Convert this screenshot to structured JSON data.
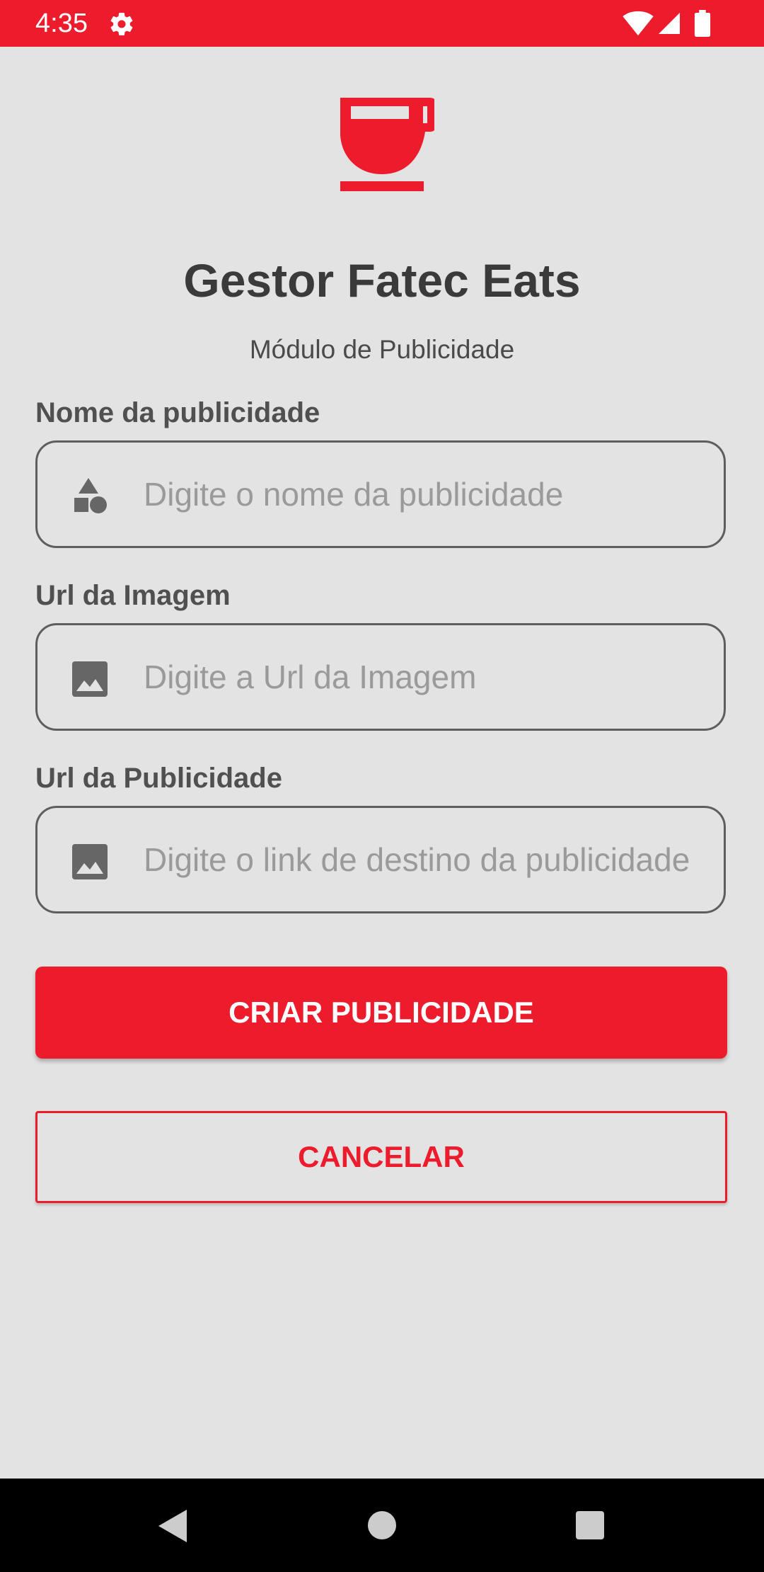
{
  "status_bar": {
    "time": "4:35",
    "icons": [
      "gear-icon",
      "wifi-icon",
      "signal-icon",
      "battery-icon"
    ],
    "background": "#ec1c2c"
  },
  "header": {
    "logo_icon": "coffee-cup-icon",
    "title": "Gestor Fatec Eats",
    "subtitle": "Módulo de Publicidade"
  },
  "form": {
    "fields": [
      {
        "label": "Nome da publicidade",
        "placeholder": "Digite o nome da publicidade",
        "value": "",
        "icon": "shapes-icon"
      },
      {
        "label": "Url da Imagem",
        "placeholder": "Digite a Url da Imagem",
        "value": "",
        "icon": "image-icon"
      },
      {
        "label": "Url da Publicidade",
        "placeholder": "Digite o link de destino da publicidade",
        "value": "",
        "icon": "image-icon"
      }
    ],
    "submit_label": "CRIAR PUBLICIDADE",
    "cancel_label": "CANCELAR"
  },
  "nav_bar": {
    "icons": [
      "back-icon",
      "home-icon",
      "recents-icon"
    ]
  },
  "colors": {
    "accent": "#ec1c2c",
    "background": "#e3e3e3",
    "text": "#3a3a3a"
  }
}
